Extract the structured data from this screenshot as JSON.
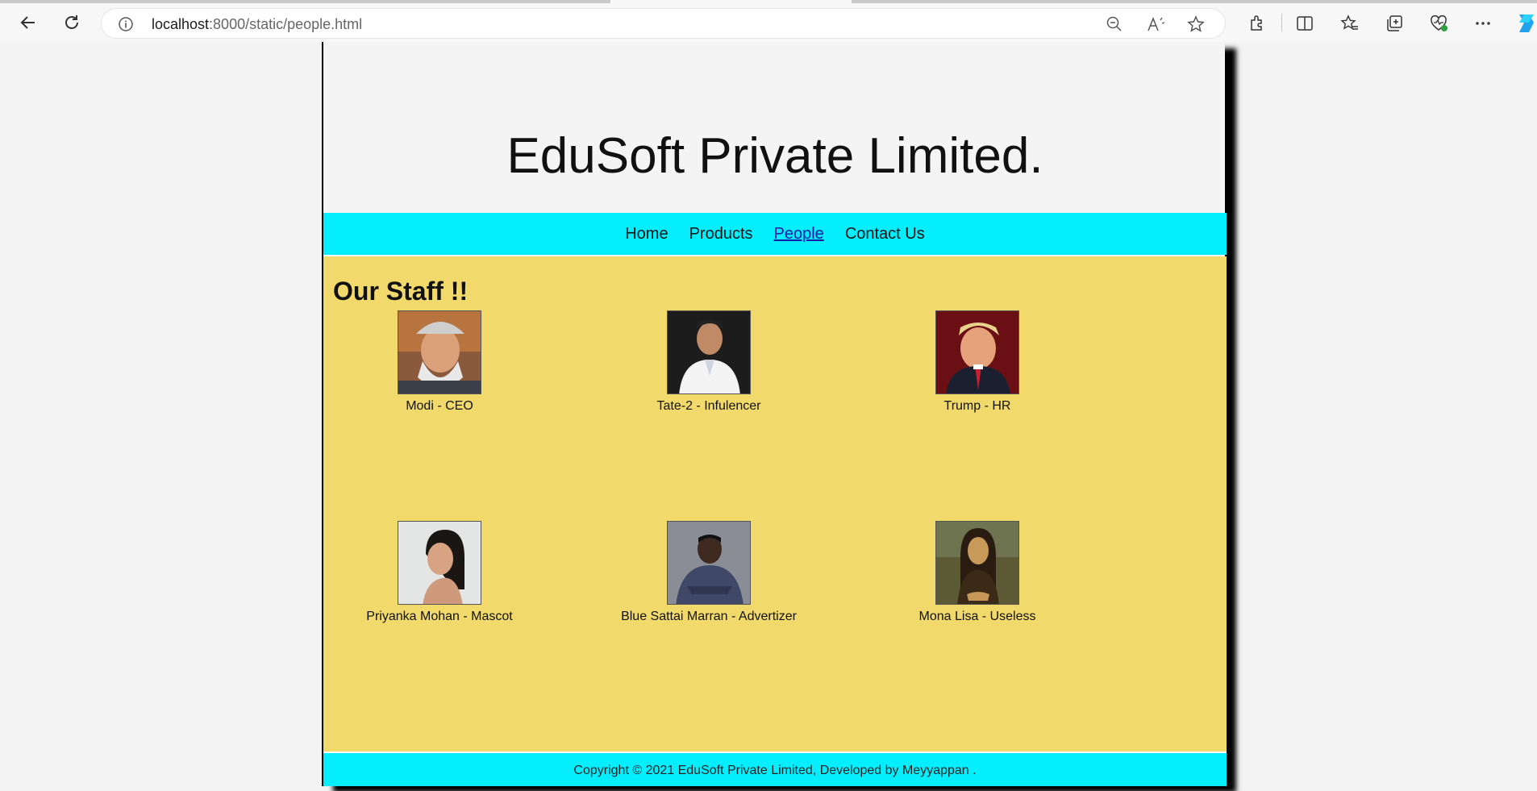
{
  "browser": {
    "url_host": "localhost",
    "url_path": ":8000/static/people.html"
  },
  "site": {
    "title": "EduSoft Private Limited.",
    "nav": [
      {
        "label": "Home"
      },
      {
        "label": "Products"
      },
      {
        "label": "People",
        "active": true
      },
      {
        "label": "Contact Us"
      }
    ],
    "heading": "Our Staff !!",
    "staff": [
      {
        "caption": "Modi - CEO"
      },
      {
        "caption": "Tate-2 - Infulencer"
      },
      {
        "caption": "Trump - HR"
      },
      {
        "caption": "Priyanka Mohan - Mascot"
      },
      {
        "caption": "Blue Sattai Marran - Advertizer"
      },
      {
        "caption": "Mona Lisa - Useless"
      }
    ],
    "footer": "Copyright © 2021 EduSoft Private Limited, Developed by Meyyappan ."
  },
  "colors": {
    "nav_bg": "#05eefe",
    "content_bg": "#f1da6b",
    "active_link": "#1a1aa8"
  },
  "icons": [
    "back-icon",
    "refresh-icon",
    "info-icon",
    "zoom-out-icon",
    "read-aloud-icon",
    "favorite-star-icon",
    "extensions-icon",
    "split-screen-icon",
    "favorites-icon",
    "collections-icon",
    "browser-essentials-icon",
    "more-icon",
    "copilot-icon"
  ]
}
